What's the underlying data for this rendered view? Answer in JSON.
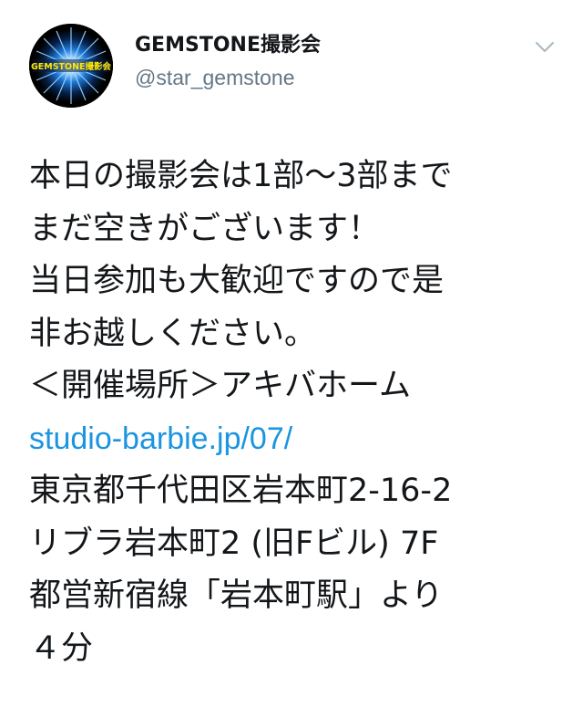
{
  "author": {
    "display_name": "GEMSTONE撮影会",
    "handle": "@star_gemstone",
    "avatar_text": "GEMSTONE撮影会",
    "avatar_icon": "starburst-logo"
  },
  "menu": {
    "icon": "chevron-down-icon"
  },
  "tweet": {
    "lines": [
      "本日の撮影会は1部〜3部まで",
      "まだ空きがございます！",
      "当日参加も大歓迎ですので是",
      "非お越しください。",
      "＜開催場所＞アキバホーム"
    ],
    "link": "studio-barbie.jp/07/",
    "address_lines": [
      "東京都千代田区岩本町2-16-2",
      "リブラ岩本町2 (旧Fビル) 7F",
      "都営新宿線「岩本町駅」より",
      "４分"
    ]
  },
  "colors": {
    "link": "#1b95e0",
    "handle": "#657786",
    "text": "#14171a"
  }
}
